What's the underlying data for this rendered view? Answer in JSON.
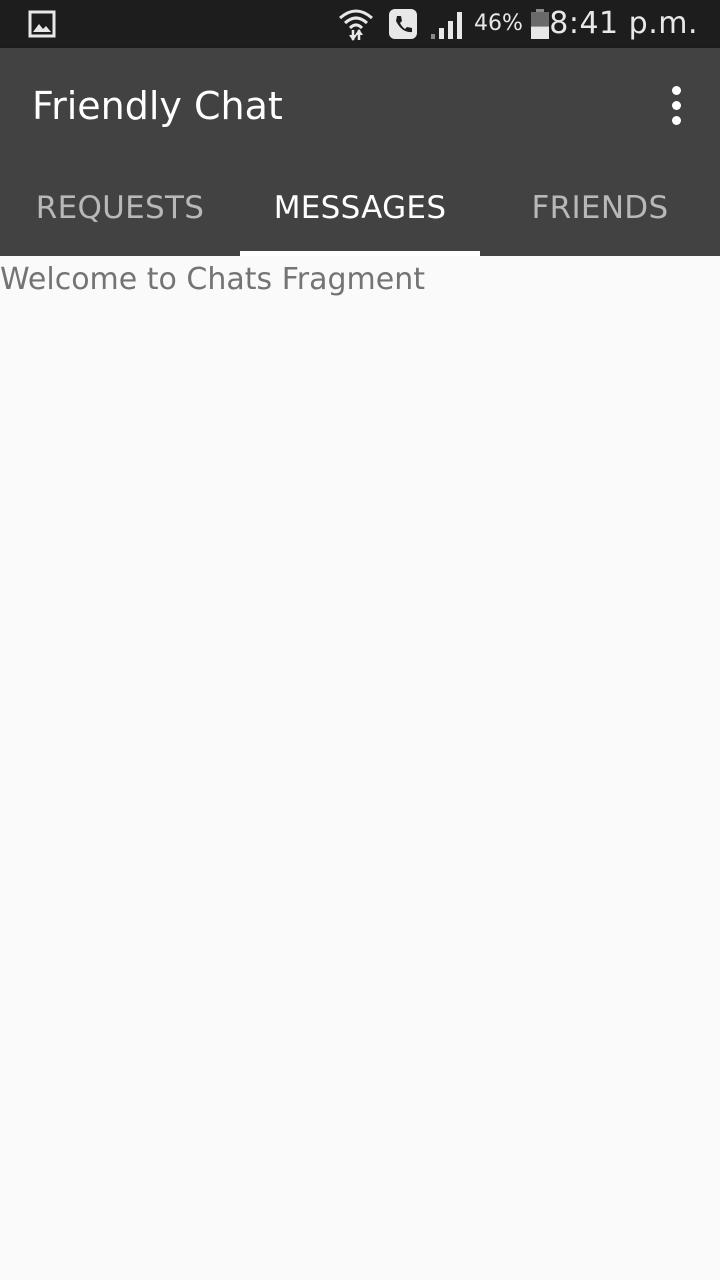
{
  "status_bar": {
    "notification_icon": "gallery-icon",
    "wifi_icon": "wifi-icon",
    "call_icon": "call-icon",
    "signal_icon": "signal-icon",
    "battery_percent": "46%",
    "battery_icon": "battery-icon",
    "battery_level": 0.46,
    "time": "8:41 p.m."
  },
  "app_bar": {
    "title": "Friendly Chat",
    "overflow_icon": "more-vert-icon",
    "tabs": [
      {
        "label": "REQUESTS",
        "selected": false
      },
      {
        "label": "MESSAGES",
        "selected": true
      },
      {
        "label": "FRIENDS",
        "selected": false
      }
    ]
  },
  "content": {
    "welcome_text": "Welcome to Chats Fragment"
  },
  "colors": {
    "status_bar_bg": "#1d1d1d",
    "app_bar_bg": "#424242",
    "content_bg": "#fafafa",
    "text_primary": "#ffffff",
    "tab_inactive": "#b8b8b8",
    "body_text": "#747474"
  }
}
